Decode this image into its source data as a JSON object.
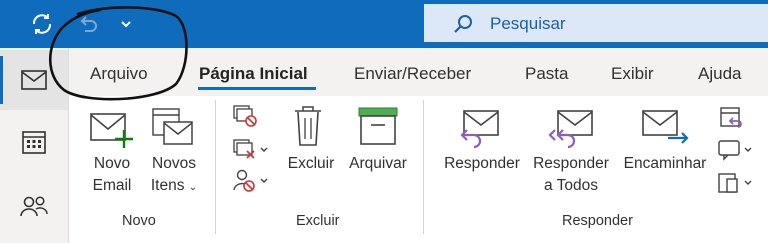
{
  "search": {
    "placeholder": "Pesquisar"
  },
  "tabs": [
    {
      "label": "Arquivo"
    },
    {
      "label": "Página Inicial"
    },
    {
      "label": "Enviar/Receber"
    },
    {
      "label": "Pasta"
    },
    {
      "label": "Exibir"
    },
    {
      "label": "Ajuda"
    }
  ],
  "ribbon": {
    "novo_email": {
      "line1": "Novo",
      "line2": "Email"
    },
    "novos_itens": {
      "line1": "Novos",
      "line2": "Itens"
    },
    "excluir": {
      "label": "Excluir"
    },
    "arquivar": {
      "label": "Arquivar"
    },
    "responder": {
      "label": "Responder"
    },
    "responder_todos": {
      "line1": "Responder",
      "line2": "a Todos"
    },
    "encaminhar": {
      "label": "Encaminhar"
    }
  },
  "groups": [
    {
      "label": "Novo"
    },
    {
      "label": "Excluir"
    },
    {
      "label": "Responder"
    }
  ],
  "colors": {
    "brand": "#0f6cbd",
    "ribbon_bg": "#f3f2f1",
    "accent_green": "#107c10",
    "accent_purple": "#8a5fc0",
    "accent_red": "#d13438"
  }
}
